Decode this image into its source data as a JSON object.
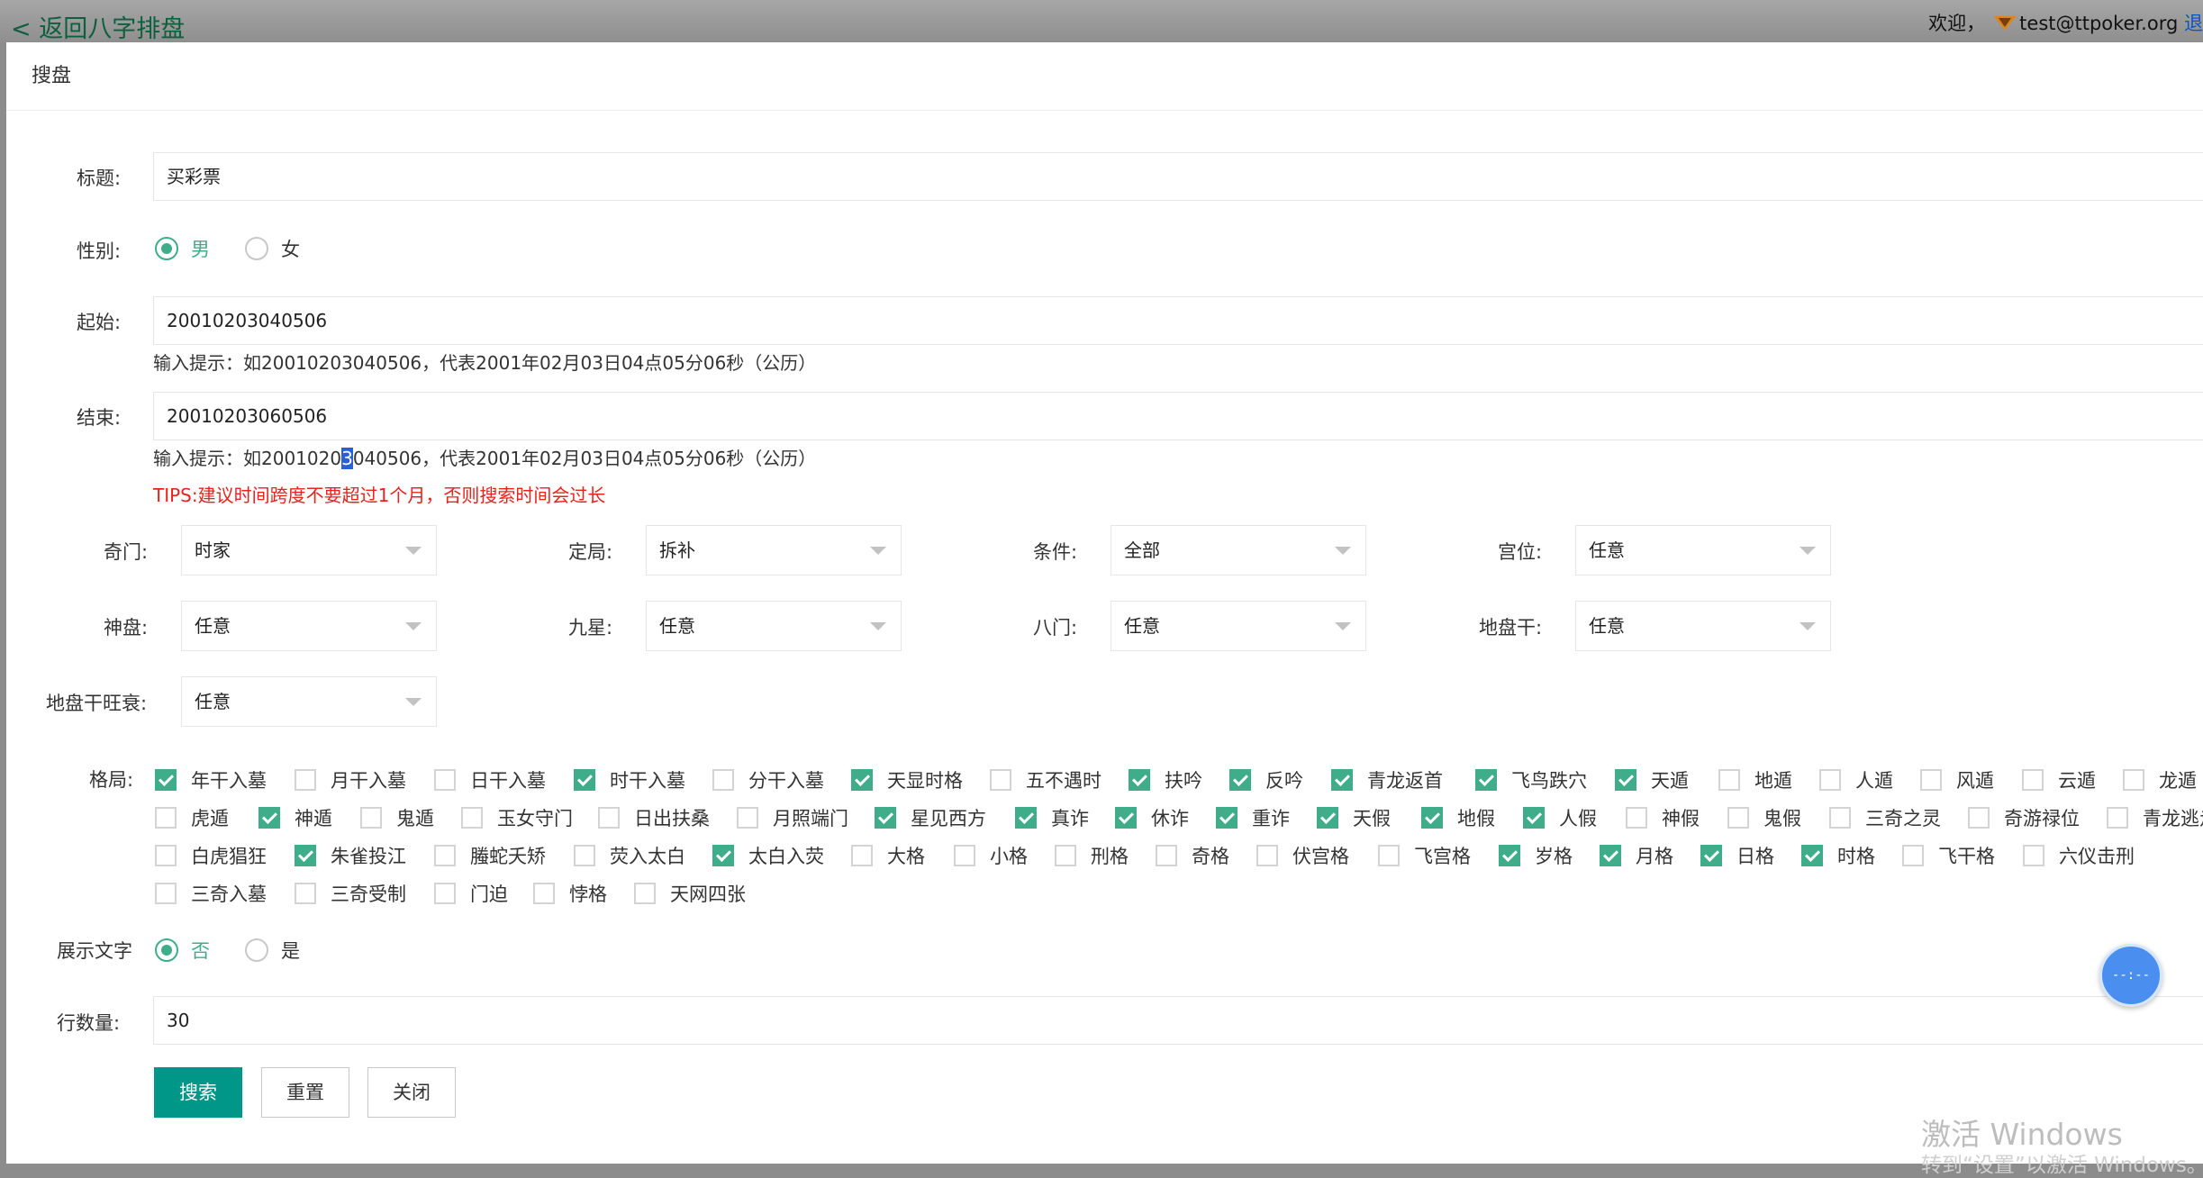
{
  "topbar": {
    "back_label": "< 返回八字排盘",
    "welcome_prefix": "欢迎，",
    "user_email": "test@ttpoker.org",
    "logout_label": "退"
  },
  "modal": {
    "title": "搜盘"
  },
  "form": {
    "title_label": "标题:",
    "title_value": "买彩票",
    "gender_label": "性别:",
    "gender_options": [
      "男",
      "女"
    ],
    "gender_selected": "男",
    "start_label": "起始:",
    "start_value": "20010203040506",
    "start_hint": "输入提示：如20010203040506，代表2001年02月03日04点05分06秒（公历）",
    "end_label": "结束:",
    "end_value": "20010203060506",
    "end_hint_before": "输入提示：如2001020",
    "end_hint_selected": "3",
    "end_hint_after": "040506，代表2001年02月03日04点05分06秒（公历）",
    "tips": "TIPS:建议时间跨度不要超过1个月，否则搜索时间会过长",
    "selects": [
      {
        "label": "奇门:",
        "value": "时家"
      },
      {
        "label": "定局:",
        "value": "拆补"
      },
      {
        "label": "条件:",
        "value": "全部"
      },
      {
        "label": "宫位:",
        "value": "任意"
      },
      {
        "label": "神盘:",
        "value": "任意"
      },
      {
        "label": "九星:",
        "value": "任意"
      },
      {
        "label": "八门:",
        "value": "任意"
      },
      {
        "label": "地盘干:",
        "value": "任意"
      },
      {
        "label": "地盘干旺衰:",
        "value": "任意"
      }
    ],
    "pattern_label": "格局:",
    "patterns": [
      [
        {
          "label": "年干入墓",
          "checked": true
        },
        {
          "label": "月干入墓",
          "checked": false
        },
        {
          "label": "日干入墓",
          "checked": false
        },
        {
          "label": "时干入墓",
          "checked": true
        },
        {
          "label": "分干入墓",
          "checked": false
        },
        {
          "label": "天显时格",
          "checked": true
        },
        {
          "label": "五不遇时",
          "checked": false
        },
        {
          "label": "扶吟",
          "checked": true
        },
        {
          "label": "反吟",
          "checked": true
        },
        {
          "label": "青龙返首",
          "checked": true
        },
        {
          "label": "飞鸟跌穴",
          "checked": true
        },
        {
          "label": "天遁",
          "checked": true
        },
        {
          "label": "地遁",
          "checked": false
        },
        {
          "label": "人遁",
          "checked": false
        },
        {
          "label": "风遁",
          "checked": false
        },
        {
          "label": "云遁",
          "checked": false
        },
        {
          "label": "龙遁",
          "checked": false
        }
      ],
      [
        {
          "label": "虎遁",
          "checked": false
        },
        {
          "label": "神遁",
          "checked": true
        },
        {
          "label": "鬼遁",
          "checked": false
        },
        {
          "label": "玉女守门",
          "checked": false
        },
        {
          "label": "日出扶桑",
          "checked": false
        },
        {
          "label": "月照端门",
          "checked": false
        },
        {
          "label": "星见西方",
          "checked": true
        },
        {
          "label": "真诈",
          "checked": true
        },
        {
          "label": "休诈",
          "checked": true
        },
        {
          "label": "重诈",
          "checked": true
        },
        {
          "label": "天假",
          "checked": true
        },
        {
          "label": "地假",
          "checked": true
        },
        {
          "label": "人假",
          "checked": true
        },
        {
          "label": "神假",
          "checked": false
        },
        {
          "label": "鬼假",
          "checked": false
        },
        {
          "label": "三奇之灵",
          "checked": false
        },
        {
          "label": "奇游禄位",
          "checked": false
        },
        {
          "label": "青龙逃走",
          "checked": false
        }
      ],
      [
        {
          "label": "白虎猖狂",
          "checked": false
        },
        {
          "label": "朱雀投江",
          "checked": true
        },
        {
          "label": "螣蛇夭矫",
          "checked": false
        },
        {
          "label": "荧入太白",
          "checked": false
        },
        {
          "label": "太白入荧",
          "checked": true
        },
        {
          "label": "大格",
          "checked": false
        },
        {
          "label": "小格",
          "checked": false
        },
        {
          "label": "刑格",
          "checked": false
        },
        {
          "label": "奇格",
          "checked": false
        },
        {
          "label": "伏宫格",
          "checked": false
        },
        {
          "label": "飞宫格",
          "checked": false
        },
        {
          "label": "岁格",
          "checked": true
        },
        {
          "label": "月格",
          "checked": true
        },
        {
          "label": "日格",
          "checked": true
        },
        {
          "label": "时格",
          "checked": true
        },
        {
          "label": "飞干格",
          "checked": false
        },
        {
          "label": "六仪击刑",
          "checked": false
        }
      ],
      [
        {
          "label": "三奇入墓",
          "checked": false
        },
        {
          "label": "三奇受制",
          "checked": false
        },
        {
          "label": "门迫",
          "checked": false
        },
        {
          "label": "悖格",
          "checked": false
        },
        {
          "label": "天网四张",
          "checked": false
        }
      ]
    ],
    "show_text_label": "展示文字",
    "show_text_options": [
      "否",
      "是"
    ],
    "show_text_selected": "否",
    "rows_label": "行数量:",
    "rows_value": "30",
    "buttons": {
      "search": "搜索",
      "reset": "重置",
      "close": "关闭"
    }
  },
  "float_widget": {
    "label": "--:--"
  },
  "watermark": {
    "line1": "激活 Windows",
    "line2": "转到“设置”以激活 Windows。"
  }
}
